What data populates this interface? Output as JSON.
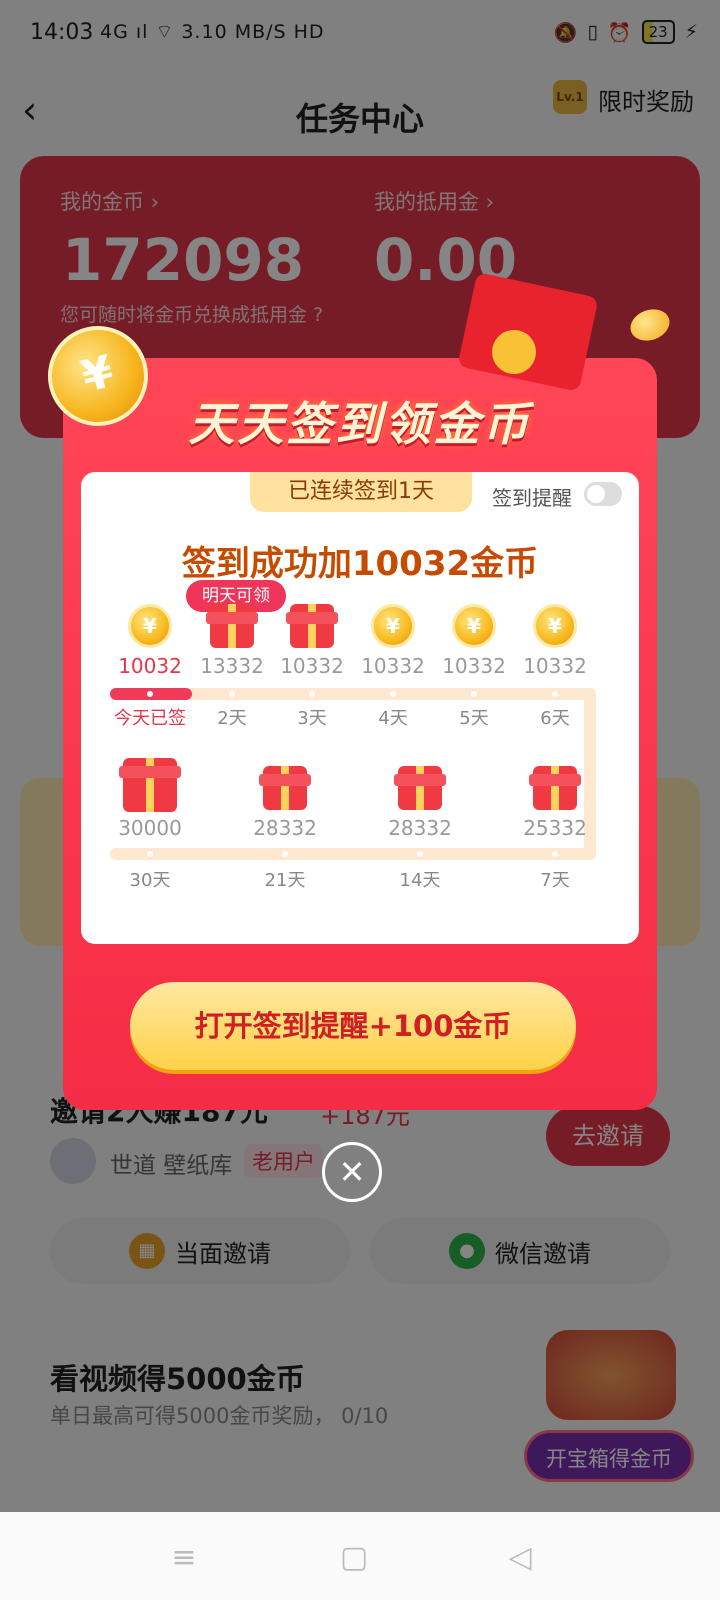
{
  "status_bar": {
    "time": "14:03",
    "network": "4G ıl ⌔ 3.10 MB/S HD",
    "battery": "23"
  },
  "header": {
    "title": "任务中心",
    "level": "Lv.1",
    "limited_reward": "限时奖励"
  },
  "balance": {
    "coins_label": "我的金币 ›",
    "coins_value": "172098",
    "deduct_label": "我的抵用金 ›",
    "deduct_value": "0.00",
    "note": "您可随时将金币兑换成抵用金 ?"
  },
  "background": {
    "invite_title": "邀请2人赚187元",
    "invite_amount": "+187元",
    "invite_button": "去邀请",
    "invite_user": "世道 壁纸库",
    "old_user": "老用户",
    "face_invite": "当面邀请",
    "wechat_invite": "微信邀请",
    "video_title": "看视频得5000金币",
    "video_sub": "单日最高可得5000金币奖励， 0/10",
    "treasure_button": "开宝箱得金币"
  },
  "modal": {
    "title": "天天签到领金币",
    "streak": "已连续签到1天",
    "remind_label": "签到提醒",
    "remind_on": false,
    "success_text": "签到成功加10032金币",
    "tomorrow_tag": "明天可领",
    "row1": [
      {
        "value": "10032",
        "label": "今天已签",
        "icon": "coin",
        "today": true
      },
      {
        "value": "13332",
        "label": "2天",
        "icon": "gift"
      },
      {
        "value": "10332",
        "label": "3天",
        "icon": "gift"
      },
      {
        "value": "10332",
        "label": "4天",
        "icon": "coin"
      },
      {
        "value": "10332",
        "label": "5天",
        "icon": "coin"
      },
      {
        "value": "10332",
        "label": "6天",
        "icon": "coin"
      }
    ],
    "row2": [
      {
        "value": "30000",
        "label": "30天",
        "icon": "gift-big"
      },
      {
        "value": "28332",
        "label": "21天",
        "icon": "gift"
      },
      {
        "value": "28332",
        "label": "14天",
        "icon": "gift"
      },
      {
        "value": "25332",
        "label": "7天",
        "icon": "gift"
      }
    ],
    "cta": "打开签到提醒+100金币",
    "close_icon": "close-icon",
    "coin_symbol": "¥"
  },
  "nav": {
    "menu_icon": "≡",
    "home_icon": "▢",
    "back_icon": "◁"
  },
  "colors": {
    "accent": "#f52c45",
    "gold": "#ffd24a",
    "overlay": "rgba(0,0,0,0.48)"
  }
}
